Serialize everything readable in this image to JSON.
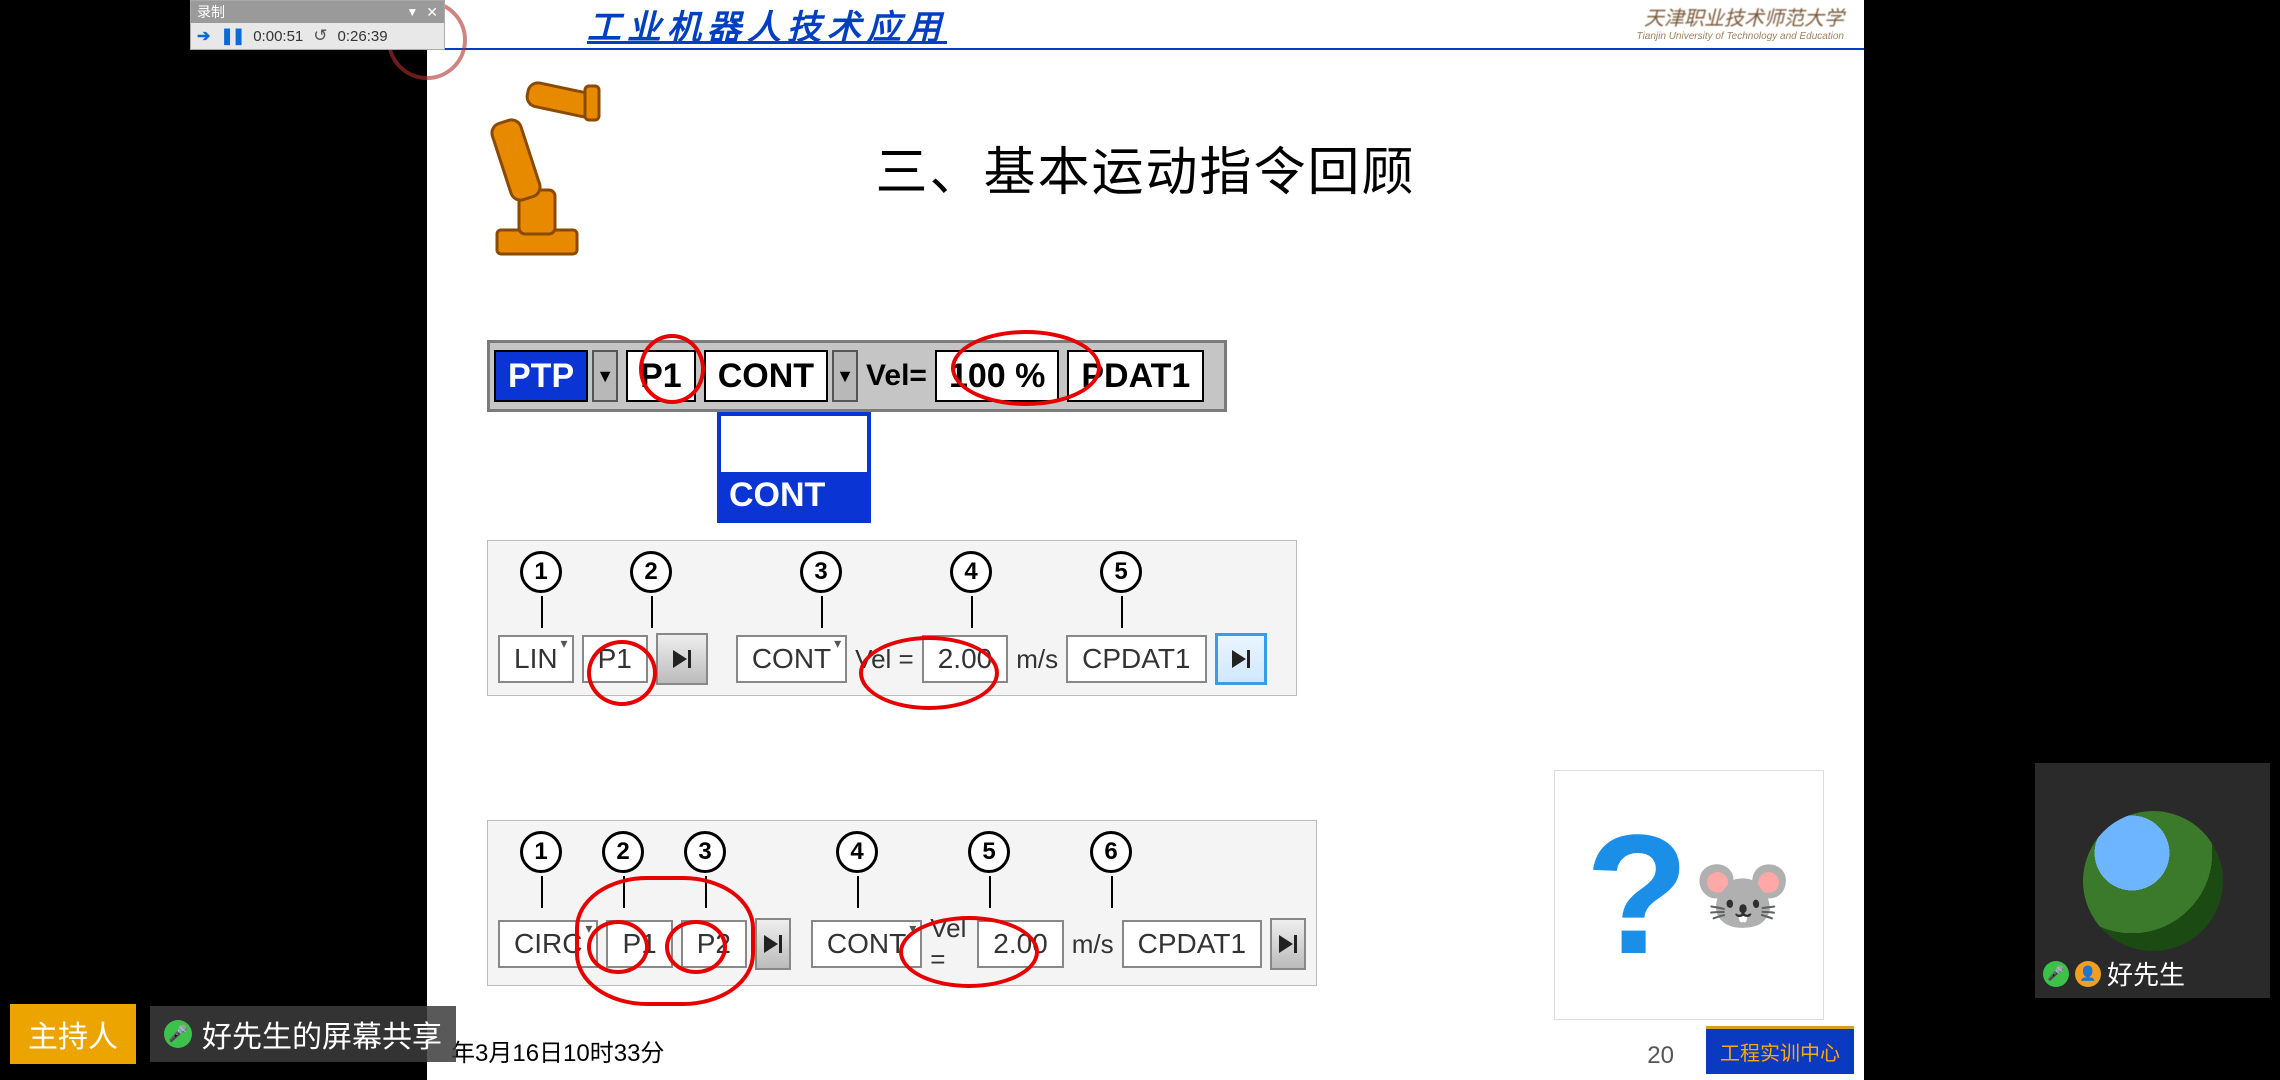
{
  "recording": {
    "title": "录制",
    "elapsed": "0:00:51",
    "total": "0:26:39"
  },
  "slide": {
    "course_title": "工业机器人技术应用",
    "university_cn": "天津职业技术师范大学",
    "university_en": "Tianjin University of Technology and Education",
    "subtitle": "三、基本运动指令回顾",
    "row1": {
      "motion": "PTP",
      "point": "P1",
      "cont": "CONT",
      "vel_label": "Vel=",
      "vel_value": "100",
      "vel_unit": "%",
      "pdat": "PDAT1",
      "cont_dropdown_option": "CONT"
    },
    "row2": {
      "bubbles": [
        "1",
        "2",
        "3",
        "4",
        "5"
      ],
      "motion": "LIN",
      "point": "P1",
      "cont": "CONT",
      "vel_label": "Vel =",
      "vel_value": "2.00",
      "vel_unit": "m/s",
      "pdat": "CPDAT1"
    },
    "row3": {
      "bubbles": [
        "1",
        "2",
        "3",
        "4",
        "5",
        "6"
      ],
      "motion": "CIRC",
      "point1": "P1",
      "point2": "P2",
      "cont": "CONT",
      "vel_label": "Vel =",
      "vel_value": "2.00",
      "vel_unit": "m/s",
      "pdat": "CPDAT1"
    },
    "page_number": "20",
    "footer_badge": "工程实训中心",
    "footer_date": "年3月16日10时33分"
  },
  "overlay": {
    "host_tag": "主持人",
    "share_text": "好先生的屏幕共享",
    "participant_name": "好先生"
  }
}
